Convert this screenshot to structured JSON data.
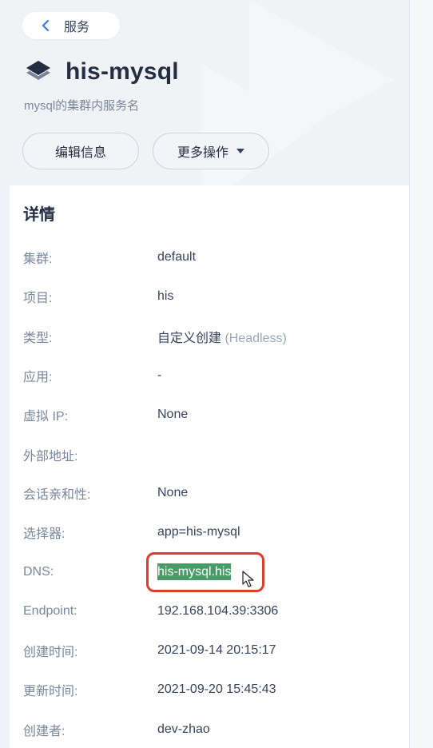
{
  "nav": {
    "back_label": "服务"
  },
  "header": {
    "title": "his-mysql",
    "subtitle": "mysql的集群内服务名"
  },
  "actions": {
    "edit_label": "编辑信息",
    "more_label": "更多操作"
  },
  "details": {
    "title": "详情",
    "rows": [
      {
        "key": "集群:",
        "value": "default"
      },
      {
        "key": "项目:",
        "value": "his"
      },
      {
        "key": "类型:",
        "value": "自定义创建",
        "value_extra": "(Headless)"
      },
      {
        "key": "应用:",
        "value": "-"
      },
      {
        "key": "虚拟 IP:",
        "value": "None"
      },
      {
        "key": "外部地址:",
        "value": ""
      },
      {
        "key": "会话亲和性:",
        "value": "None"
      },
      {
        "key": "选择器:",
        "value": "app=his-mysql"
      },
      {
        "key": "DNS:",
        "value": "his-mysql.his"
      },
      {
        "key": "Endpoint:",
        "value": "192.168.104.39:3306"
      },
      {
        "key": "创建时间:",
        "value": "2021-09-14 20:15:17"
      },
      {
        "key": "更新时间:",
        "value": "2021-09-20 15:45:43"
      },
      {
        "key": "创建者:",
        "value": "dev-zhao"
      }
    ]
  },
  "colors": {
    "highlight_bg": "#4a9a67",
    "annotation_border": "#e03c2e"
  },
  "icons": [
    "chevron-left-icon",
    "service-layers-icon",
    "caret-down-icon",
    "mouse-cursor-icon"
  ]
}
